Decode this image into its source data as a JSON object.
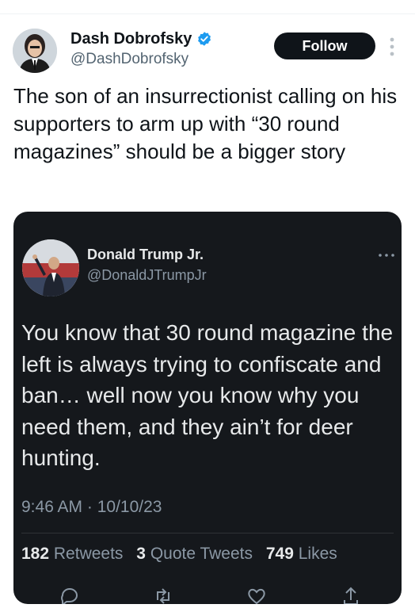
{
  "tweet": {
    "author_name": "Dash Dobrofsky",
    "author_handle": "@DashDobrofsky",
    "follow_label": "Follow",
    "text": "The son of an insurrectionist calling on his supporters to arm up with “30 round magazines” should be a bigger story"
  },
  "embedded": {
    "author_name": "Donald Trump Jr.",
    "author_handle": "@DonaldJTrumpJr",
    "text": "You know that 30 round magazine the left is always trying to confiscate and ban… well now you know why you need them, and they ain’t for deer hunting.",
    "timestamp": "9:46 AM · 10/10/23",
    "stats": {
      "retweets_count": "182",
      "retweets_label": "Retweets",
      "quotes_count": "3",
      "quotes_label": "Quote Tweets",
      "likes_count": "749",
      "likes_label": "Likes"
    }
  },
  "colors": {
    "verified": "#1d9bf0",
    "follow_bg": "#0f1419",
    "embed_bg": "#15181c"
  },
  "icons": [
    "verified-badge-icon",
    "more-vertical-icon",
    "more-horizontal-icon",
    "reply-icon",
    "retweet-icon",
    "like-icon",
    "share-icon"
  ]
}
